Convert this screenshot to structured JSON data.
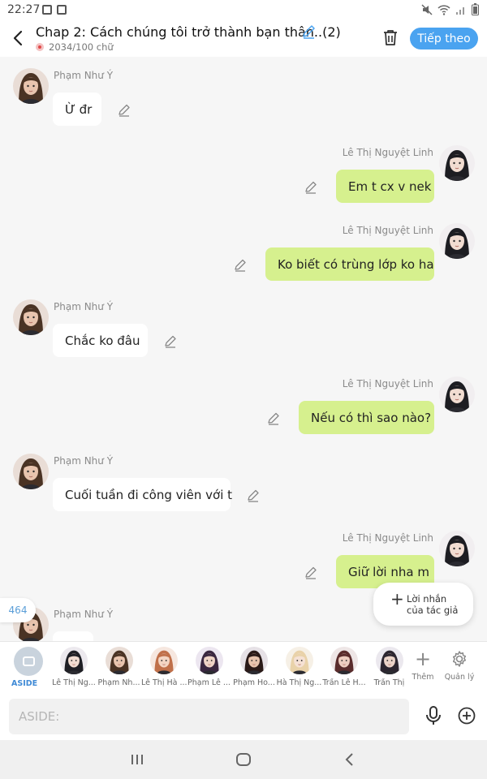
{
  "status_bar": {
    "time": "22:27"
  },
  "header": {
    "title": "Chap 2: Cách chúng tôi trở thành bạn thân..(2)",
    "word_count": "2034/100 chữ",
    "follow_button": "Tiếp theo"
  },
  "messages": [
    {
      "side": "left",
      "sender": "Phạm Như Ý",
      "text": "Ừ đr"
    },
    {
      "side": "right",
      "sender": "Lê Thị Nguyệt Linh",
      "text": "Em t cx v nek"
    },
    {
      "side": "right",
      "sender": "Lê Thị Nguyệt Linh",
      "text": "Ko biết có trùng lớp ko ha"
    },
    {
      "side": "left",
      "sender": "Phạm Như Ý",
      "text": "Chắc ko đâu"
    },
    {
      "side": "right",
      "sender": "Lê Thị Nguyệt Linh",
      "text": "Nếu có thì sao nào?"
    },
    {
      "side": "left",
      "sender": "Phạm Như Ý",
      "text": "Cuối tuần đi công viên với t"
    },
    {
      "side": "right",
      "sender": "Lê Thị Nguyệt Linh",
      "text": "Giữ lời nha m"
    },
    {
      "side": "left",
      "sender": "Phạm Như Ý",
      "text": ""
    }
  ],
  "count_badge": "464",
  "author_note": {
    "line1": "Lời nhắn",
    "line2": "của tác giả"
  },
  "characters": {
    "aside_label": "ASIDE",
    "list": [
      {
        "label": "Lê Thị Ng..."
      },
      {
        "label": "Phạm Nh..."
      },
      {
        "label": "Lê Thị Hà ..."
      },
      {
        "label": "Phạm Lê ..."
      },
      {
        "label": "Phạm Ho..."
      },
      {
        "label": "Hà Thị Ng..."
      },
      {
        "label": "Trần Lê H..."
      },
      {
        "label": "Trần Thị"
      }
    ],
    "add_label": "Thêm",
    "manage_label": "Quản lý"
  },
  "input": {
    "placeholder": "ASIDE:"
  }
}
